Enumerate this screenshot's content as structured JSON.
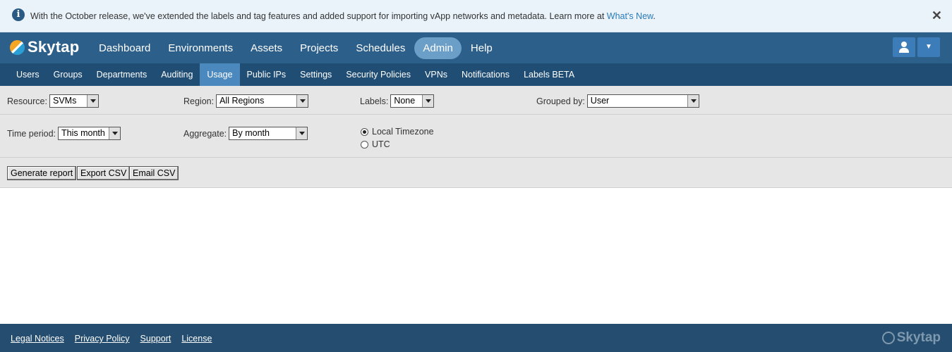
{
  "banner": {
    "message": "With the October release, we've extended the labels and tag features and added support for importing vApp networks and metadata. Learn more at ",
    "link": "What's New",
    "suffix": ".",
    "close": "✕"
  },
  "brand": {
    "name": "Skytap"
  },
  "topnav": {
    "items": [
      "Dashboard",
      "Environments",
      "Assets",
      "Projects",
      "Schedules",
      "Admin",
      "Help"
    ],
    "active": "Admin"
  },
  "subnav": {
    "items": [
      "Users",
      "Groups",
      "Departments",
      "Auditing",
      "Usage",
      "Public IPs",
      "Settings",
      "Security Policies",
      "VPNs",
      "Notifications",
      "Labels BETA"
    ],
    "active": "Usage"
  },
  "filters": {
    "resource": {
      "label": "Resource:",
      "value": "SVMs"
    },
    "region": {
      "label": "Region:",
      "value": "All Regions"
    },
    "labels": {
      "label": "Labels:",
      "value": "None"
    },
    "grouped_by": {
      "label": "Grouped by:",
      "value": "User"
    },
    "time_period": {
      "label": "Time period:",
      "value": "This month"
    },
    "aggregate": {
      "label": "Aggregate:",
      "value": "By month"
    },
    "timezone": {
      "options": [
        "Local Timezone",
        "UTC"
      ],
      "selected": "Local Timezone"
    }
  },
  "actions": {
    "generate": "Generate report",
    "export": "Export CSV",
    "email": "Email CSV"
  },
  "footer": {
    "links": [
      "Legal Notices",
      "Privacy Policy",
      "Support",
      "License"
    ],
    "brand": "Skytap"
  },
  "colors": {
    "nav": "#2d5f8b",
    "subnav": "#1f4d73",
    "active_pill": "#6b9fc7",
    "link": "#2b7bb9"
  }
}
